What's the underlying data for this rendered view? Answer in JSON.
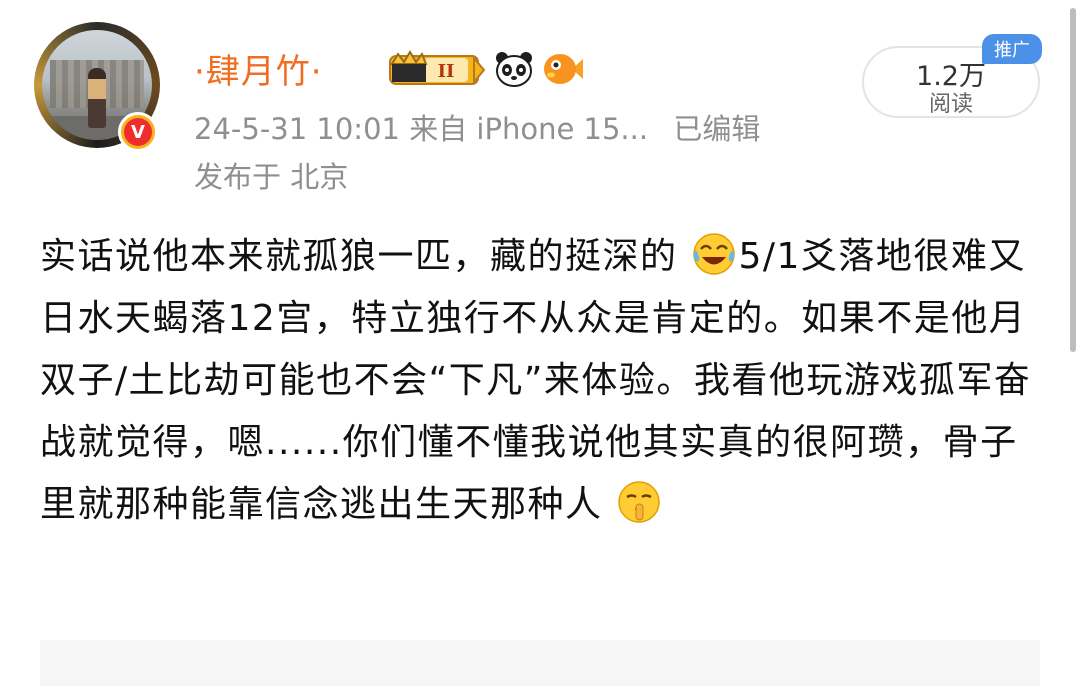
{
  "post": {
    "username": "·肆月竹·",
    "timestamp": "24-5-31 10:01",
    "source": "来自 iPhone 15...",
    "edited": "已编辑",
    "location": "发布于 北京",
    "reads": {
      "count": "1.2万",
      "label": "阅读"
    },
    "ad_tag": "推广",
    "verified_mark": "V",
    "level_badge": "II",
    "content": {
      "part1": "实话说他本来就孤狼一匹，藏的挺深的",
      "part2": "5/1爻落地很难又日水天蝎落12宫，特立独行不从众是肯定的。如果不是他月双子/土比劫可能也不会“下凡”来体验。我看他玩游戏孤军奋战就觉得，嗯......你们懂不懂我说他其实真的很阿瓒，骨子里就那种能靠信念逃出生天那种人"
    },
    "icons": {
      "avatar": "user-avatar-photo",
      "verified": "verified-badge-icon",
      "crown": "crown-level-icon",
      "panda": "panda-icon",
      "fish": "fish-icon",
      "emoji1": "laughing-crying-emoji",
      "emoji2": "shush-emoji"
    },
    "colors": {
      "username": "#f26d21",
      "meta": "#8f8f8f",
      "ad_tag": "#4d90e8"
    }
  }
}
